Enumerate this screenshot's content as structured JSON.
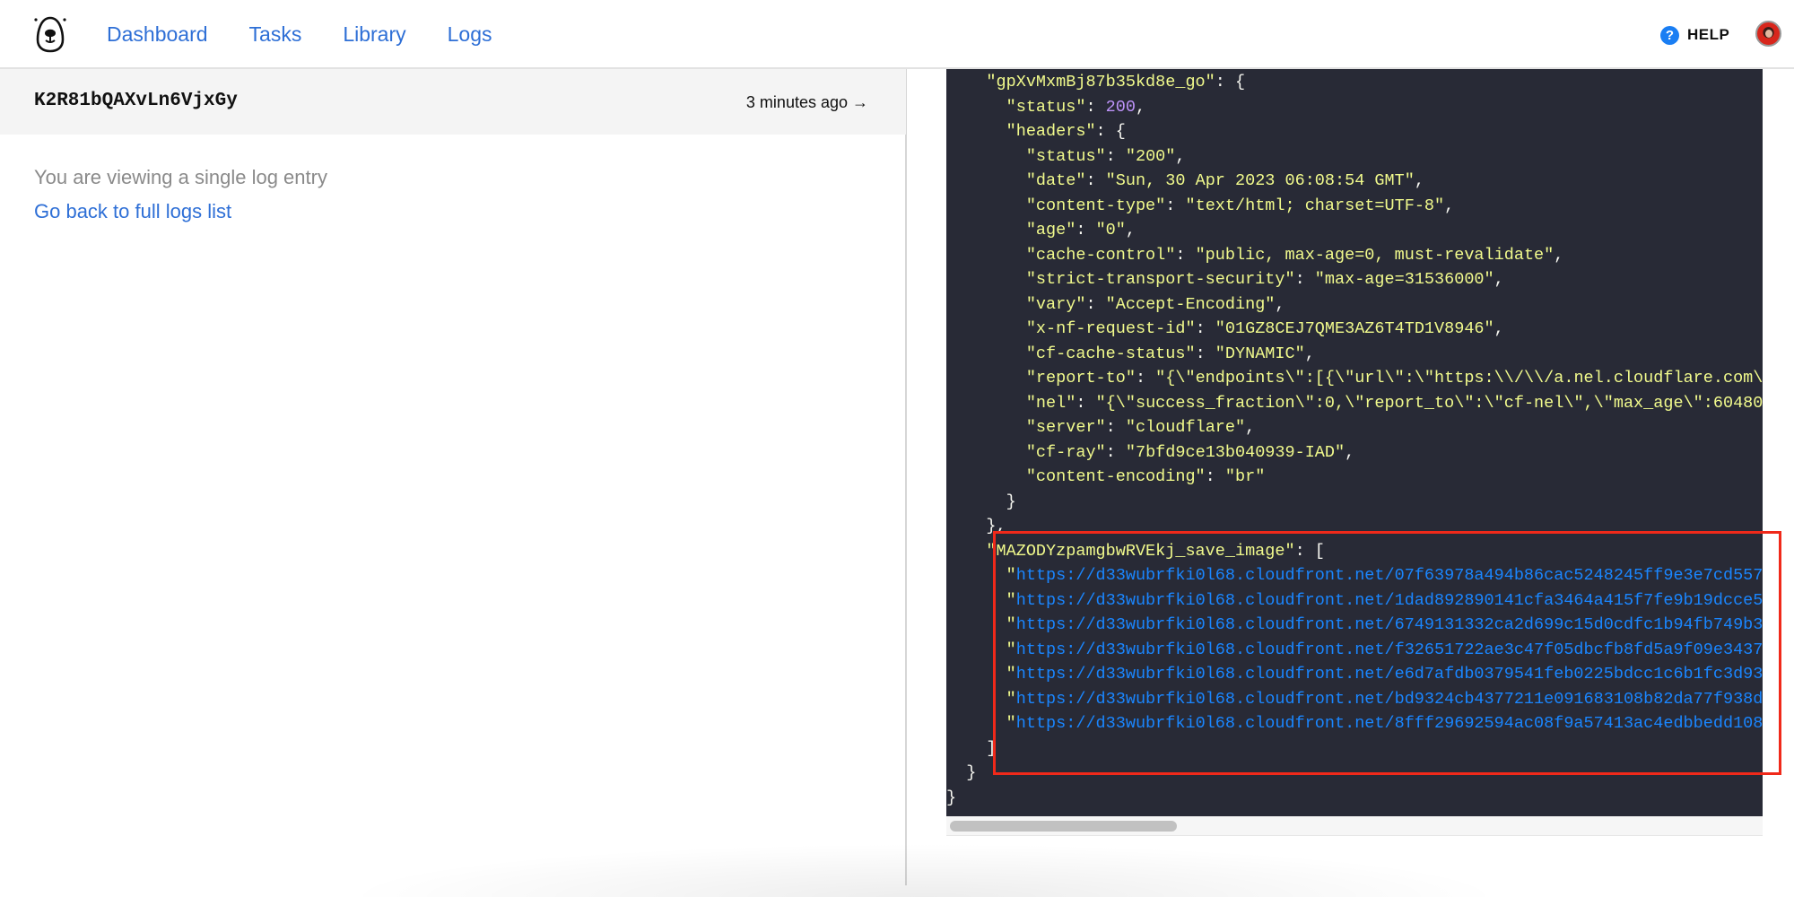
{
  "nav": {
    "logo": "bear-logo",
    "items": [
      {
        "label": "Dashboard"
      },
      {
        "label": "Tasks"
      },
      {
        "label": "Library"
      },
      {
        "label": "Logs"
      }
    ],
    "help_label": "HELP",
    "help_icon": "question-circle-icon",
    "avatar": "user-avatar"
  },
  "entry": {
    "id": "K2R81bQAXvLn6VjxGy",
    "time": "3 minutes ago →",
    "viewing_text": "You are viewing a single log entry",
    "back_link": "Go back to full logs list"
  },
  "code": {
    "lines": [
      {
        "indent": "    ",
        "parts": [
          [
            "k",
            "\"gpXvMxmBj87b35kd8e_go\""
          ],
          [
            "p",
            ": {"
          ]
        ]
      },
      {
        "indent": "      ",
        "parts": [
          [
            "k",
            "\"status\""
          ],
          [
            "p",
            ": "
          ],
          [
            "n",
            "200"
          ],
          [
            "p",
            ","
          ]
        ]
      },
      {
        "indent": "      ",
        "parts": [
          [
            "k",
            "\"headers\""
          ],
          [
            "p",
            ": {"
          ]
        ]
      },
      {
        "indent": "        ",
        "parts": [
          [
            "k",
            "\"status\""
          ],
          [
            "p",
            ": "
          ],
          [
            "s",
            "\"200\""
          ],
          [
            "p",
            ","
          ]
        ]
      },
      {
        "indent": "        ",
        "parts": [
          [
            "k",
            "\"date\""
          ],
          [
            "p",
            ": "
          ],
          [
            "s",
            "\"Sun, 30 Apr 2023 06:08:54 GMT\""
          ],
          [
            "p",
            ","
          ]
        ]
      },
      {
        "indent": "        ",
        "parts": [
          [
            "k",
            "\"content-type\""
          ],
          [
            "p",
            ": "
          ],
          [
            "s",
            "\"text/html; charset=UTF-8\""
          ],
          [
            "p",
            ","
          ]
        ]
      },
      {
        "indent": "        ",
        "parts": [
          [
            "k",
            "\"age\""
          ],
          [
            "p",
            ": "
          ],
          [
            "s",
            "\"0\""
          ],
          [
            "p",
            ","
          ]
        ]
      },
      {
        "indent": "        ",
        "parts": [
          [
            "k",
            "\"cache-control\""
          ],
          [
            "p",
            ": "
          ],
          [
            "s",
            "\"public, max-age=0, must-revalidate\""
          ],
          [
            "p",
            ","
          ]
        ]
      },
      {
        "indent": "        ",
        "parts": [
          [
            "k",
            "\"strict-transport-security\""
          ],
          [
            "p",
            ": "
          ],
          [
            "s",
            "\"max-age=31536000\""
          ],
          [
            "p",
            ","
          ]
        ]
      },
      {
        "indent": "        ",
        "parts": [
          [
            "k",
            "\"vary\""
          ],
          [
            "p",
            ": "
          ],
          [
            "s",
            "\"Accept-Encoding\""
          ],
          [
            "p",
            ","
          ]
        ]
      },
      {
        "indent": "        ",
        "parts": [
          [
            "k",
            "\"x-nf-request-id\""
          ],
          [
            "p",
            ": "
          ],
          [
            "s",
            "\"01GZ8CEJ7QME3AZ6T4TD1V8946\""
          ],
          [
            "p",
            ","
          ]
        ]
      },
      {
        "indent": "        ",
        "parts": [
          [
            "k",
            "\"cf-cache-status\""
          ],
          [
            "p",
            ": "
          ],
          [
            "s",
            "\"DYNAMIC\""
          ],
          [
            "p",
            ","
          ]
        ]
      },
      {
        "indent": "        ",
        "parts": [
          [
            "k",
            "\"report-to\""
          ],
          [
            "p",
            ": "
          ],
          [
            "s",
            "\"{\\\"endpoints\\\":[{\\\"url\\\":\\\"https:\\\\/\\\\/a.nel.cloudflare.com\\"
          ]
        ]
      },
      {
        "indent": "        ",
        "parts": [
          [
            "k",
            "\"nel\""
          ],
          [
            "p",
            ": "
          ],
          [
            "s",
            "\"{\\\"success_fraction\\\":0,\\\"report_to\\\":\\\"cf-nel\\\",\\\"max_age\\\":60480"
          ]
        ]
      },
      {
        "indent": "        ",
        "parts": [
          [
            "k",
            "\"server\""
          ],
          [
            "p",
            ": "
          ],
          [
            "s",
            "\"cloudflare\""
          ],
          [
            "p",
            ","
          ]
        ]
      },
      {
        "indent": "        ",
        "parts": [
          [
            "k",
            "\"cf-ray\""
          ],
          [
            "p",
            ": "
          ],
          [
            "s",
            "\"7bfd9ce13b040939-IAD\""
          ],
          [
            "p",
            ","
          ]
        ]
      },
      {
        "indent": "        ",
        "parts": [
          [
            "k",
            "\"content-encoding\""
          ],
          [
            "p",
            ": "
          ],
          [
            "s",
            "\"br\""
          ]
        ]
      },
      {
        "indent": "      ",
        "parts": [
          [
            "p",
            "}"
          ]
        ]
      },
      {
        "indent": "    ",
        "parts": [
          [
            "p",
            "},"
          ]
        ]
      },
      {
        "indent": "    ",
        "parts": [
          [
            "k",
            "\"MAZODYzpamgbwRVEkj_save_image\""
          ],
          [
            "p",
            ": ["
          ]
        ]
      },
      {
        "indent": "      ",
        "parts": [
          [
            "q",
            "\""
          ],
          [
            "u",
            "https://d33wubrfki0l68.cloudfront.net/07f63978a494b86cac5248245ff9e3e7cd557"
          ]
        ]
      },
      {
        "indent": "      ",
        "parts": [
          [
            "q",
            "\""
          ],
          [
            "u",
            "https://d33wubrfki0l68.cloudfront.net/1dad892890141cfa3464a415f7fe9b19dcce5"
          ]
        ]
      },
      {
        "indent": "      ",
        "parts": [
          [
            "q",
            "\""
          ],
          [
            "u",
            "https://d33wubrfki0l68.cloudfront.net/6749131332ca2d699c15d0cdfc1b94fb749b3"
          ]
        ]
      },
      {
        "indent": "      ",
        "parts": [
          [
            "q",
            "\""
          ],
          [
            "u",
            "https://d33wubrfki0l68.cloudfront.net/f32651722ae3c47f05dbcfb8fd5a9f09e3437"
          ]
        ]
      },
      {
        "indent": "      ",
        "parts": [
          [
            "q",
            "\""
          ],
          [
            "u",
            "https://d33wubrfki0l68.cloudfront.net/e6d7afdb0379541feb0225bdcc1c6b1fc3d93"
          ]
        ]
      },
      {
        "indent": "      ",
        "parts": [
          [
            "q",
            "\""
          ],
          [
            "u",
            "https://d33wubrfki0l68.cloudfront.net/bd9324cb4377211e091683108b82da77f938d"
          ]
        ]
      },
      {
        "indent": "      ",
        "parts": [
          [
            "q",
            "\""
          ],
          [
            "u",
            "https://d33wubrfki0l68.cloudfront.net/8fff29692594ac08f9a57413ac4edbbedd108"
          ]
        ]
      },
      {
        "indent": "    ",
        "parts": [
          [
            "p",
            "]"
          ]
        ]
      },
      {
        "indent": "  ",
        "parts": [
          [
            "p",
            "}"
          ]
        ]
      },
      {
        "indent": "",
        "parts": [
          [
            "p",
            "}"
          ]
        ]
      }
    ]
  },
  "colors": {
    "link": "#2e6fd6",
    "code_bg": "#282a36",
    "code_string": "#f1fa8c",
    "code_number": "#bd93f9",
    "code_url": "#1a86ff",
    "highlight_border": "#f0291a"
  }
}
